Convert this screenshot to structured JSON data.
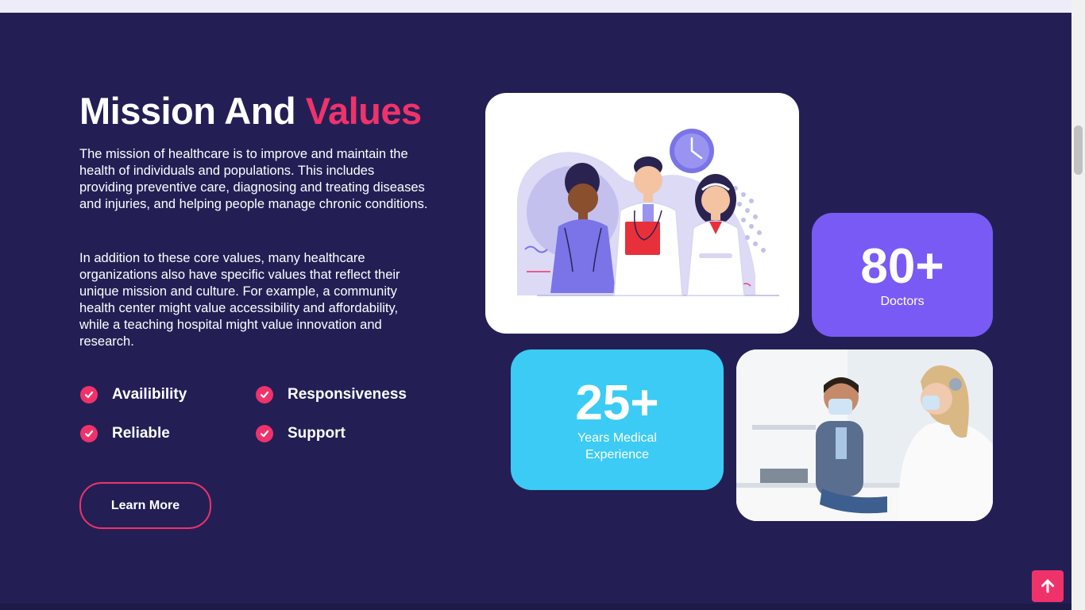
{
  "mission": {
    "title_main": "Mission And",
    "title_accent": "Values",
    "paragraph1": "The mission of healthcare is to improve and maintain the health of individuals and populations. This includes providing preventive care, diagnosing and treating diseases and injuries, and helping people manage chronic conditions.",
    "paragraph2": "In addition to these core values, many healthcare organizations also have specific values that reflect their unique mission and culture. For example, a community health center might value accessibility and affordability, while a teaching hospital might value innovation and research.",
    "features": [
      "Availibility",
      "Responsiveness",
      "Reliable",
      "Support"
    ],
    "button_label": "Learn More"
  },
  "stats": {
    "doctors": {
      "value": "80+",
      "label": "Doctors"
    },
    "experience": {
      "value": "25+",
      "label": "Years Medical Experience"
    }
  },
  "colors": {
    "background": "#231f55",
    "accent": "#f0326b",
    "doctors_card": "#7a5af5",
    "experience_card": "#3ccbf4"
  },
  "icons": {
    "feature": "check-circle-icon",
    "scroll_top": "arrow-up-icon"
  }
}
